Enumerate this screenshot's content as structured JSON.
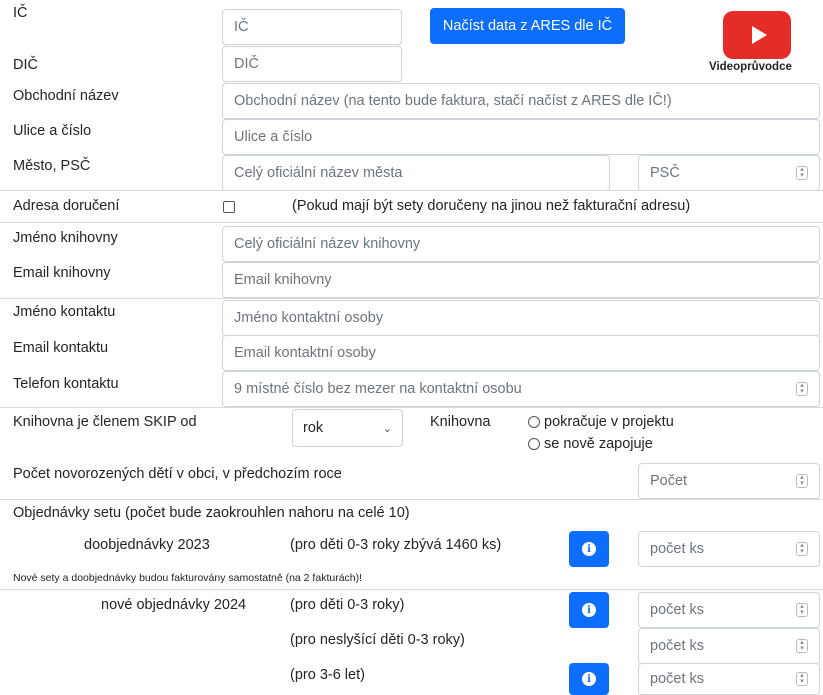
{
  "header": {
    "partial_title": "…………………………………………"
  },
  "fields": {
    "ic": {
      "label": "IČ",
      "placeholder": "IČ"
    },
    "dic": {
      "label": "DIČ",
      "placeholder": "DIČ"
    },
    "ares_button": "Načíst data z ARES dle IČ",
    "video_label": "Videoprůvodce",
    "obchodni_nazev": {
      "label": "Obchodní název",
      "placeholder": "Obchodní název (na tento bude faktura, stačí načíst z ARES dle IČ!)"
    },
    "ulice": {
      "label": "Ulice a číslo",
      "placeholder": "Ulice a číslo"
    },
    "mesto": {
      "label": "Město, PSČ",
      "placeholder": "Celý oficiální název města",
      "psc_placeholder": "PSČ"
    },
    "adresa_doruceni": {
      "label": "Adresa doručení",
      "note": "(Pokud mají být sety doručeny na jinou než fakturační adresu)"
    },
    "jmeno_knihovny": {
      "label": "Jméno knihovny",
      "placeholder": "Celý oficiální název knihovny"
    },
    "email_knihovny": {
      "label": "Email knihovny",
      "placeholder": "Email knihovny"
    },
    "jmeno_kontaktu": {
      "label": "Jméno kontaktu",
      "placeholder": "Jméno kontaktní osoby"
    },
    "email_kontaktu": {
      "label": "Email kontaktu",
      "placeholder": "Email kontaktní osoby"
    },
    "telefon_kontaktu": {
      "label": "Telefon kontaktu",
      "placeholder": "9 místné číslo bez mezer na kontaktní osobu"
    },
    "skip": {
      "label": "Knihovna je členem SKIP od",
      "select_value": "rok"
    },
    "knihovna": {
      "label": "Knihovna",
      "options": [
        "pokračuje v projektu",
        "se nově zapojuje"
      ]
    },
    "pocet_deti": {
      "label": "Počet novorozených dětí v obci, v předchozím roce",
      "placeholder": "Počet"
    }
  },
  "orders": {
    "heading": "Objednávky setu (počet bude zaokrouhlen nahoru na celé 10)",
    "doobjednavky_label": "doobjednávky 2023",
    "doobjednavky_note": "(pro děti 0-3 roky zbývá 1460 ks)",
    "notice": "Nové sety a doobjednávky budou fakturovány samostatně (na 2 fakturách)!",
    "nove_label": "nové objednávky 2024",
    "rows": [
      {
        "note": "(pro děti 0-3 roky)",
        "placeholder": "počet ks",
        "info": true
      },
      {
        "note": "(pro neslyšící děti 0-3 roky)",
        "placeholder": "počet ks",
        "info": false
      },
      {
        "note": "(pro 3-6 let)",
        "placeholder": "počet ks",
        "info": true
      }
    ],
    "qty_placeholder": "počet ks"
  }
}
